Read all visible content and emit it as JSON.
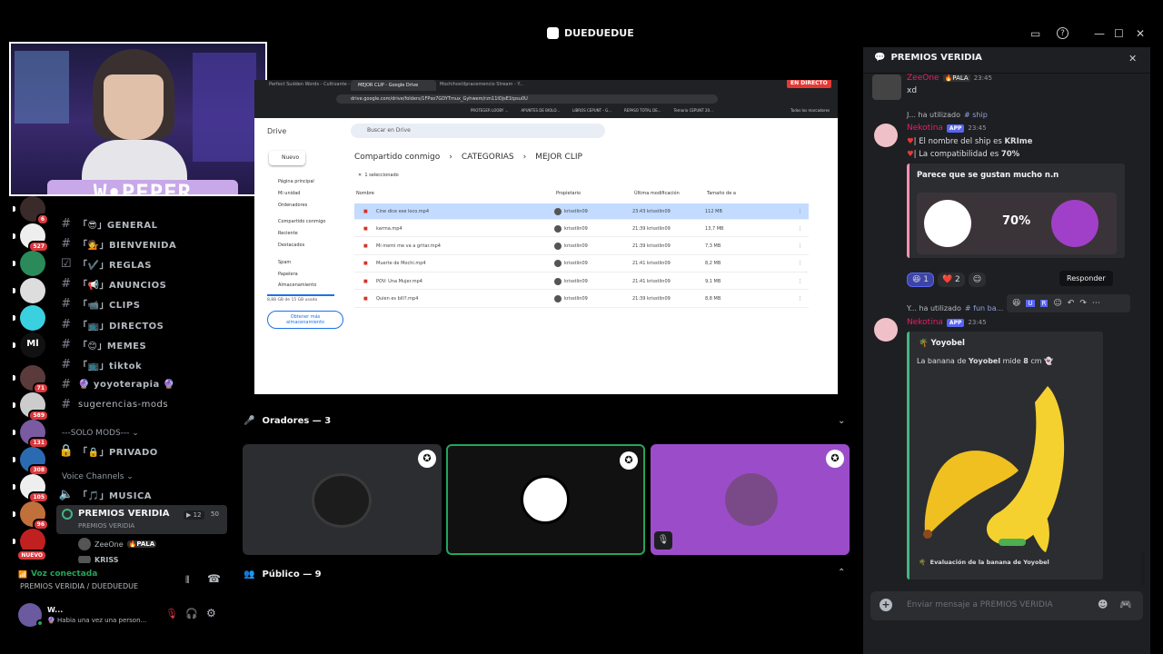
{
  "window": {
    "title": "DUEDUEDUE"
  },
  "streamer": {
    "overlay_name": "W•PEPER"
  },
  "servers": [
    {
      "badge": "6"
    },
    {
      "badge": "527"
    },
    {
      "badge": ""
    },
    {
      "badge": ""
    },
    {
      "badge": ""
    },
    {
      "badge": "",
      "label": "Ml"
    },
    {
      "badge": "71"
    },
    {
      "badge": "589"
    },
    {
      "badge": "131"
    },
    {
      "badge": "308"
    },
    {
      "badge": "105"
    },
    {
      "badge": "96"
    },
    {
      "badge": "NUEVO"
    }
  ],
  "channels": [
    {
      "icon": "#",
      "label": "「😎」GENERAL"
    },
    {
      "icon": "#",
      "label": "「💁」BIENVENIDA"
    },
    {
      "icon": "☑",
      "label": "「✔️」REGLAS"
    },
    {
      "icon": "#",
      "label": "「📢」ANUNCIOS"
    },
    {
      "icon": "#",
      "label": "「📹」CLIPS"
    },
    {
      "icon": "#",
      "label": "「📺」DIRECTOS"
    },
    {
      "icon": "#",
      "label": "「😊」MEMES"
    },
    {
      "icon": "#",
      "label": "「📺」tiktok"
    },
    {
      "icon": "#",
      "label": "🔮 yoyoterapia 🔮"
    },
    {
      "icon": "#",
      "label": "sugerencias-mods"
    }
  ],
  "solo_mods": "---SOLO MODS--- ⌄",
  "privado": "「🔒」PRIVADO",
  "voice_channels_label": "Voice Channels ⌄",
  "musica": "「🎵」MUSICA",
  "stage": {
    "name": "PREMIOS VERIDIA",
    "sub": "PREMIOS VERIDIA",
    "count_a": "12",
    "count_b": "50"
  },
  "stage_members": [
    {
      "name": "ZeeOne",
      "tag": "🔥PALA"
    },
    {
      "name": "KRISS",
      "tag": ""
    }
  ],
  "voice": {
    "status": "Voz conectada",
    "location": "PREMIOS VERIDIA / DUEDUEDUE"
  },
  "user": {
    "name": "W...",
    "status": "🔮 Habia una vez una person..."
  },
  "browser": {
    "tabs": [
      "Perfect Sudden Words - Cultivante - Y...",
      "MEJOR CLIP - Google Drive",
      "Mochihostilpracemencio Stream - Y..."
    ],
    "url": "drive.google.com/drive/folders/1FPxo7GDYTmux_Gyhwem/rzn11lOjsE1tpsu0U",
    "bookmarks": [
      "PROTEGER LOOBY ...",
      "APUNTES DE BIOLO...",
      "LIBROS CEPUNT - G...",
      "REPASO TOTAL DE...",
      "Temario CEPUNT 20...",
      "Todos los marcadores"
    ],
    "live": "EN DIRECTO"
  },
  "drive": {
    "logo": "Drive",
    "search": "Buscar en Drive",
    "new": "Nuevo",
    "nav": [
      "Página principal",
      "Mi unidad",
      "Ordenadores",
      "Compartido conmigo",
      "Reciente",
      "Destacados",
      "Spam",
      "Papelera",
      "Almacenamiento"
    ],
    "storage": "8,88 GB de 15 GB usado",
    "storage_btn": "Obtener más almacenamiento",
    "breadcrumb": [
      "Compartido conmigo",
      "CATEGORIAS",
      "MEJOR CLIP"
    ],
    "selected": "1 seleccionado",
    "headers": [
      "Nombre",
      "Propietario",
      "Última modificación",
      "Tamaño de a"
    ],
    "files": [
      {
        "name": "Cine dice ese loco.mp4",
        "owner": "krisstlin09",
        "date": "23:43 krisstlin09",
        "size": "112 MB"
      },
      {
        "name": "karma.mp4",
        "owner": "krisstlin09",
        "date": "21:39 krisstlin09",
        "size": "13,7 MB"
      },
      {
        "name": "Mi memi me va a gritar.mp4",
        "owner": "krisstlin09",
        "date": "21:39 krisstlin09",
        "size": "7,3 MB"
      },
      {
        "name": "Muerte de Mochi.mp4",
        "owner": "krisstlin09",
        "date": "21:41 krisstlin09",
        "size": "8,2 MB"
      },
      {
        "name": "POV: Una Mujer.mp4",
        "owner": "krisstlin09",
        "date": "21:41 krisstlin09",
        "size": "9,1 MB"
      },
      {
        "name": "Quien es bill?.mp4",
        "owner": "krisstlin09",
        "date": "21:39 krisstlin09",
        "size": "8,8 MB"
      }
    ]
  },
  "speakers_label": "Oradores — 3",
  "public_label": "Público — 9",
  "chat": {
    "title": "PREMIOS VERIDIA",
    "m1": {
      "name": "ZeeOne",
      "tag": "🔥PALA",
      "time": "23:45",
      "text": "xd"
    },
    "m2_reply": "J... ha utilizado",
    "m2_cmd": "# ship",
    "m2": {
      "name": "Nekotina",
      "app": "APP",
      "time": "23:45",
      "line1": "| El nombre del ship es ",
      "ship": "KRIme",
      "line2": "| La compatibilidad es ",
      "pct": "70%"
    },
    "embed1_title": "Parece que se gustan mucho n.n",
    "embed1_pct": "70%",
    "reactions": [
      "😆 1",
      "❤️ 2"
    ],
    "tooltip": "Responder",
    "m3_reply": "Y... ha utilizado",
    "m3_cmd": "# fun ba...",
    "m3": {
      "name": "Nekotina",
      "app": "APP",
      "time": "23:45"
    },
    "embed2_title": "Yoyobel",
    "embed2_text_a": "La banana de ",
    "embed2_text_b": "Yoyobel",
    "embed2_text_c": " mide ",
    "embed2_text_d": "8",
    "embed2_text_e": " cm 👻",
    "embed2_footer": "Evaluación de la banana de Yoyobel",
    "input_placeholder": "Enviar mensaje a PREMIOS VERIDIA"
  }
}
